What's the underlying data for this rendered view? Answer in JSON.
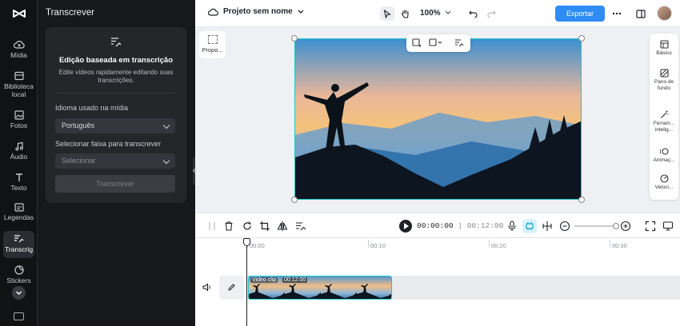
{
  "sidebar": {
    "items": [
      {
        "label": "Mídia",
        "icon": "cloud-upload-icon"
      },
      {
        "label": "Biblioteca local",
        "icon": "library-icon"
      },
      {
        "label": "Fotos",
        "icon": "image-icon"
      },
      {
        "label": "Áudio",
        "icon": "music-icon"
      },
      {
        "label": "Texto",
        "icon": "text-icon"
      },
      {
        "label": "Legendas",
        "icon": "captions-icon"
      },
      {
        "label": "Transcrig",
        "icon": "transcript-icon"
      },
      {
        "label": "Stickers",
        "icon": "sticker-icon"
      }
    ],
    "active": "Transcrig"
  },
  "panel": {
    "title": "Transcrever",
    "card_heading": "Edição baseada em transcrição",
    "card_description": "Edite vídeos rapidamente editando suas transcrições.",
    "language_label": "Idioma usado na mídia",
    "language_value": "Português",
    "track_label": "Selecionar faixa para transcrever",
    "track_placeholder": "Selecionar",
    "transcribe_button": "Transcrever"
  },
  "topbar": {
    "project_name": "Projeto sem nome",
    "zoom": "100%",
    "export_label": "Exportar",
    "accent_color": "#2f8cf5"
  },
  "stage": {
    "proportion_label": "Propo...",
    "right_tools": [
      {
        "label": "Básico",
        "icon": "basic-icon"
      },
      {
        "label": "Pano de fundo",
        "icon": "background-icon"
      },
      {
        "label": "Ferram... intelig...",
        "icon": "magic-wand-icon"
      },
      {
        "label": "Animaç...",
        "icon": "animation-icon"
      },
      {
        "label": "Veloci...",
        "icon": "speed-icon"
      }
    ]
  },
  "timeline": {
    "current_time": "00:00:00",
    "duration": "00:12:00",
    "ruler": [
      "00:00",
      "00:10",
      "00:20",
      "00:30"
    ],
    "clip_label": "Video clip",
    "clip_duration": "00:12:00"
  }
}
